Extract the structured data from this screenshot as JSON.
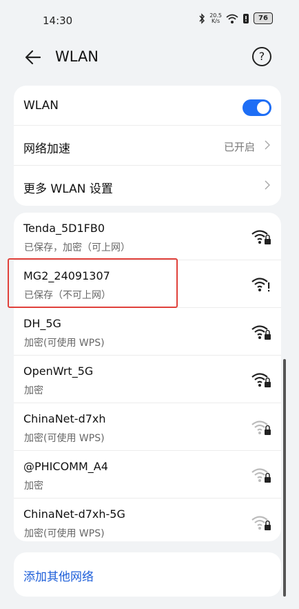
{
  "status": {
    "time": "14:30",
    "speed_top": "20.5",
    "speed_bottom": "K/s",
    "battery": "76"
  },
  "header": {
    "title": "WLAN",
    "help": "?"
  },
  "settings": {
    "wlan_label": "WLAN",
    "wlan_on": true,
    "accel_label": "网络加速",
    "accel_value": "已开启",
    "more_label": "更多 WLAN 设置"
  },
  "networks": [
    {
      "name": "Tenda_5D1FB0",
      "status": "已保存，加密（可上网）",
      "icon": "wifi-lock-icon"
    },
    {
      "name": "MG2_24091307",
      "status": "已保存（不可上网）",
      "icon": "wifi-warning-icon"
    },
    {
      "name": "DH_5G",
      "status": "加密(可使用 WPS)",
      "icon": "wifi-lock-icon"
    },
    {
      "name": "OpenWrt_5G",
      "status": "加密",
      "icon": "wifi-lock-icon"
    },
    {
      "name": "ChinaNet-d7xh",
      "status": "加密(可使用 WPS)",
      "icon": "wifi-lock-weak-icon"
    },
    {
      "name": "@PHICOMM_A4",
      "status": "加密",
      "icon": "wifi-lock-weak-icon"
    },
    {
      "name": "ChinaNet-d7xh-5G",
      "status": "加密(可使用 WPS)",
      "icon": "wifi-lock-weak-icon"
    }
  ],
  "add_network": "添加其他网络",
  "colors": {
    "accent": "#1e6ef5",
    "highlight": "#e0403a",
    "background": "#f1f3f5"
  }
}
